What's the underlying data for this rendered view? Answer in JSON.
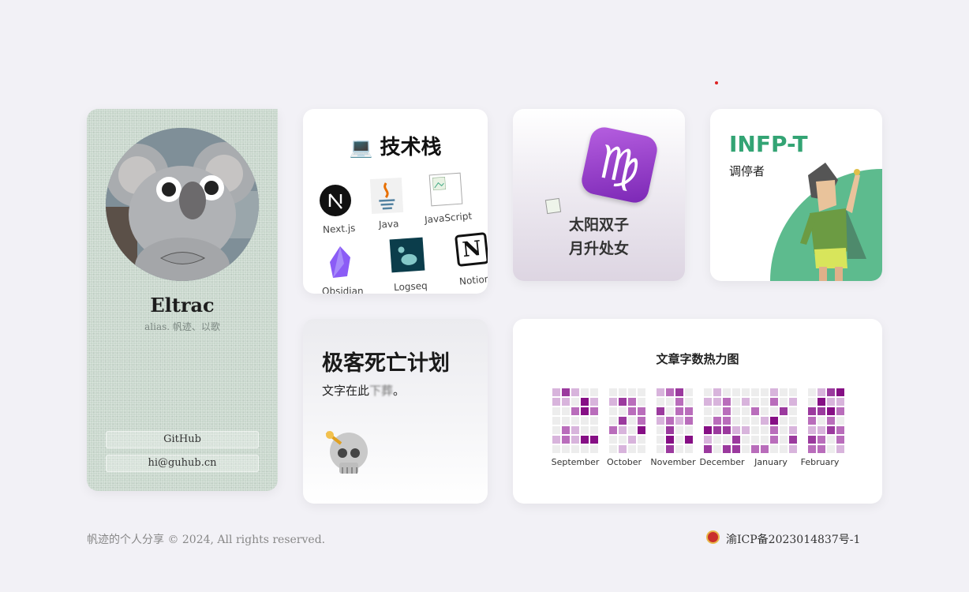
{
  "profile": {
    "name": "Eltrac",
    "alias": "alias. 帆迹、以歌",
    "links": [
      "GitHub",
      "hi@guhub.cn"
    ]
  },
  "tech": {
    "title": "技术栈",
    "items": [
      "Next.js",
      "Java",
      "JavaScript",
      "Obsidian",
      "Logseq",
      "Notion"
    ]
  },
  "zodiac": {
    "line1": "太阳双子",
    "line2": "月升处女",
    "sign": "♍"
  },
  "mbti": {
    "type": "INFP-T",
    "role": "调停者"
  },
  "geek": {
    "title": "极客死亡计划",
    "desc_prefix": "文字在此",
    "desc_blur": "下葬",
    "desc_suffix": "。"
  },
  "heatmap": {
    "title": "文章字数热力图",
    "months": [
      "September",
      "October",
      "November",
      "December",
      "January",
      "February"
    ],
    "colors": [
      "#ededed",
      "#d8b4dc",
      "#b96dbb",
      "#9b3a9e",
      "#860f85"
    ]
  },
  "footer": {
    "copyright": "帆迹的个人分享 © 2024, All rights reserved.",
    "icp": "渝ICP备2023014837号-1"
  }
}
